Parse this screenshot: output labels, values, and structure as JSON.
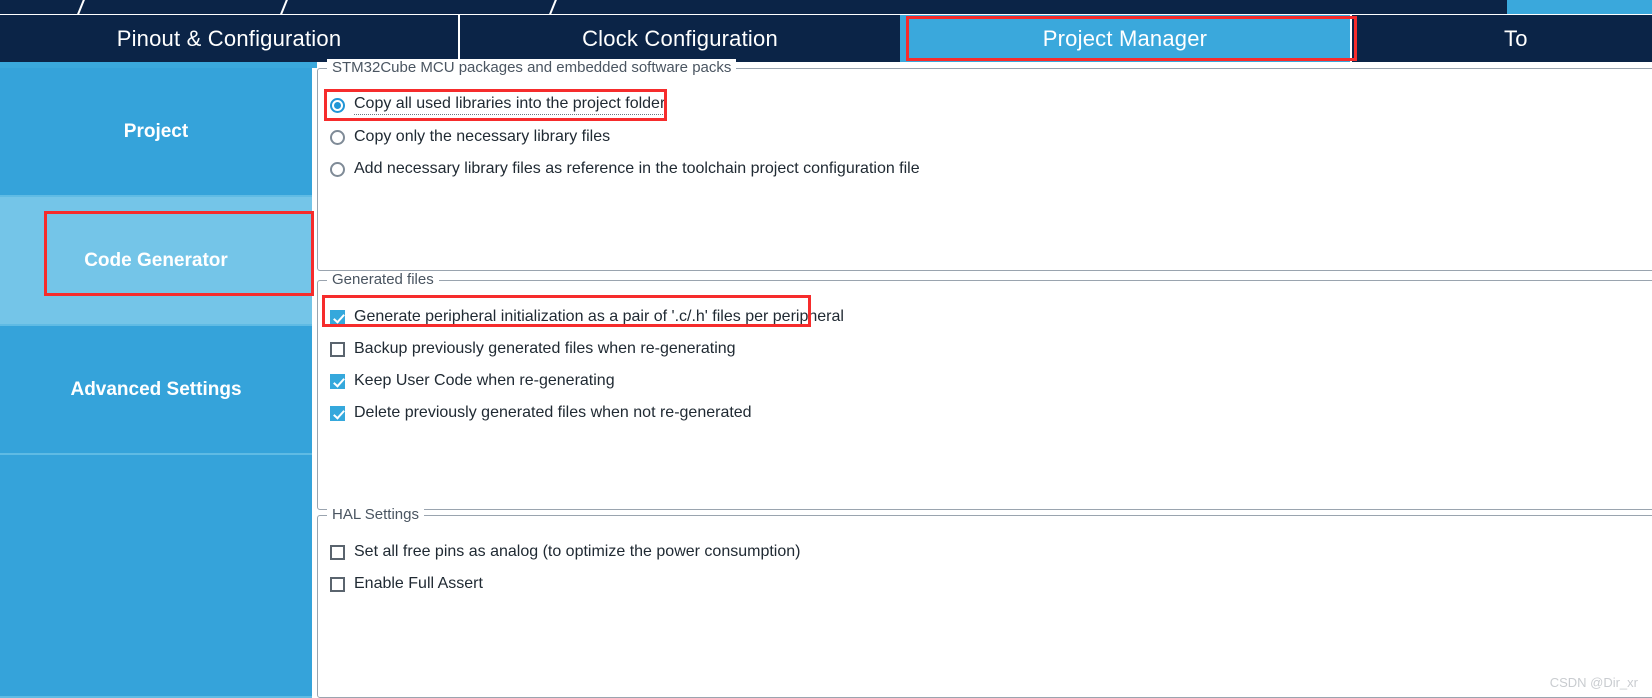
{
  "window": {
    "title": "STM32CubeMX - Project Manager - Code Generator"
  },
  "breadcrumb": {
    "separator_icon": "slash-separator-icon"
  },
  "tabs": [
    {
      "id": "pinout",
      "label": "Pinout & Configuration",
      "active": false
    },
    {
      "id": "clock",
      "label": "Clock Configuration",
      "active": false
    },
    {
      "id": "project-manager",
      "label": "Project Manager",
      "active": true
    },
    {
      "id": "tools",
      "label": "To",
      "active": false
    }
  ],
  "sidebar": {
    "items": [
      {
        "id": "project",
        "label": "Project",
        "selected": false
      },
      {
        "id": "code-generator",
        "label": "Code Generator",
        "selected": true
      },
      {
        "id": "advanced-settings",
        "label": "Advanced Settings",
        "selected": false
      },
      {
        "id": "blank",
        "label": "",
        "selected": false
      }
    ]
  },
  "groups": {
    "packages": {
      "title": "STM32Cube MCU packages and embedded software packs",
      "options": [
        {
          "id": "copy-all-libraries",
          "label": "Copy all used libraries into the project folder",
          "checked": true
        },
        {
          "id": "copy-necessary-only",
          "label": "Copy only the necessary library files",
          "checked": false
        },
        {
          "id": "add-as-reference",
          "label": "Add necessary library files as reference in the toolchain project configuration file",
          "checked": false
        }
      ]
    },
    "generated": {
      "title": "Generated files",
      "options": [
        {
          "id": "generate-peripheral-pair",
          "label": "Generate peripheral initialization as a pair of '.c/.h' files per peripheral",
          "checked": true
        },
        {
          "id": "backup-previous",
          "label": "Backup previously generated files when re-generating",
          "checked": false
        },
        {
          "id": "keep-user-code",
          "label": "Keep User Code when re-generating",
          "checked": true
        },
        {
          "id": "delete-not-regenerated",
          "label": "Delete previously generated files when not re-generated",
          "checked": true
        }
      ]
    },
    "hal": {
      "title": "HAL Settings",
      "options": [
        {
          "id": "free-pins-analog",
          "label": "Set all free pins as analog (to optimize the power consumption)",
          "checked": false
        },
        {
          "id": "enable-full-assert",
          "label": "Enable Full Assert",
          "checked": false
        }
      ]
    }
  },
  "annotations": [
    {
      "id": "tab-highlight",
      "target": "Project Manager tab"
    },
    {
      "id": "sidebar-code-generator",
      "target": "Code Generator sidebar item"
    },
    {
      "id": "copy-all-libraries-highlight",
      "target": "Copy all used libraries into the project folder"
    },
    {
      "id": "generate-peripheral-highlight",
      "target": "Generate peripheral initialization as a pair of '.c/.h' files per peripheral"
    }
  ],
  "watermark": {
    "text": "CSDN @Dir_xr"
  },
  "colors": {
    "navy": "#0b2447",
    "cyan": "#3aa8dc",
    "sidebar_blue": "#35a3da",
    "sidebar_selected": "#74c5e8",
    "annotation_red": "#f62c2c",
    "checkbox_checked": "#35a8dc",
    "radio_checked": "#2196d6"
  }
}
